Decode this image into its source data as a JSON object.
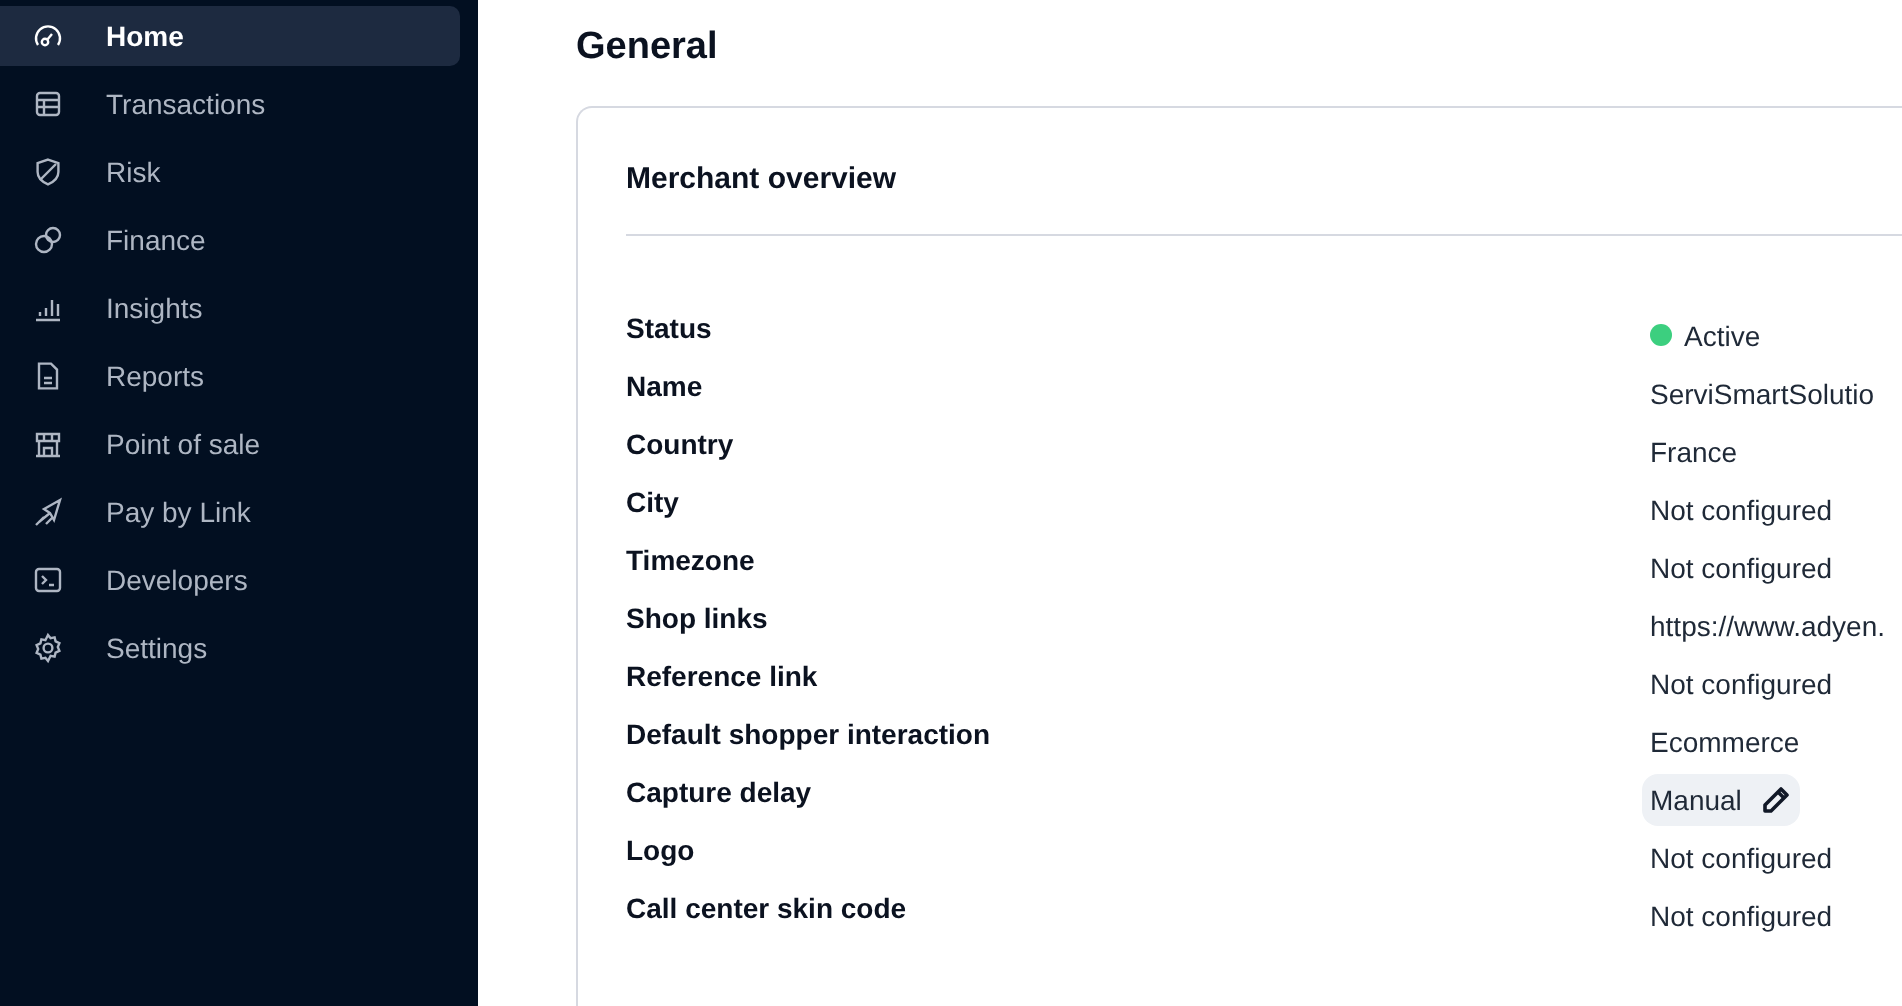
{
  "sidebar": {
    "items": [
      {
        "label": "Home",
        "selected": true
      },
      {
        "label": "Transactions",
        "selected": false
      },
      {
        "label": "Risk",
        "selected": false
      },
      {
        "label": "Finance",
        "selected": false
      },
      {
        "label": "Insights",
        "selected": false
      },
      {
        "label": "Reports",
        "selected": false
      },
      {
        "label": "Point of sale",
        "selected": false
      },
      {
        "label": "Pay by Link",
        "selected": false
      },
      {
        "label": "Developers",
        "selected": false
      },
      {
        "label": "Settings",
        "selected": false
      }
    ]
  },
  "page": {
    "title": "General"
  },
  "card": {
    "title": "Merchant overview",
    "rows": [
      {
        "label": "Status",
        "value": "Active",
        "kind": "status",
        "color": "#3ccf7f"
      },
      {
        "label": "Name",
        "value": "ServiSmartSolutio",
        "kind": "text"
      },
      {
        "label": "Country",
        "value": "France",
        "kind": "text"
      },
      {
        "label": "City",
        "value": "Not configured",
        "kind": "text"
      },
      {
        "label": "Timezone",
        "value": "Not configured",
        "kind": "text"
      },
      {
        "label": "Shop links",
        "value": "https://www.adyen.",
        "kind": "text"
      },
      {
        "label": "Reference link",
        "value": "Not configured",
        "kind": "text"
      },
      {
        "label": "Default shopper interaction",
        "value": "Ecommerce",
        "kind": "text"
      },
      {
        "label": "Capture delay",
        "value": "Manual",
        "kind": "editable"
      },
      {
        "label": "Logo",
        "value": "Not configured",
        "kind": "text"
      },
      {
        "label": "Call center skin code",
        "value": "Not configured",
        "kind": "text"
      }
    ]
  }
}
